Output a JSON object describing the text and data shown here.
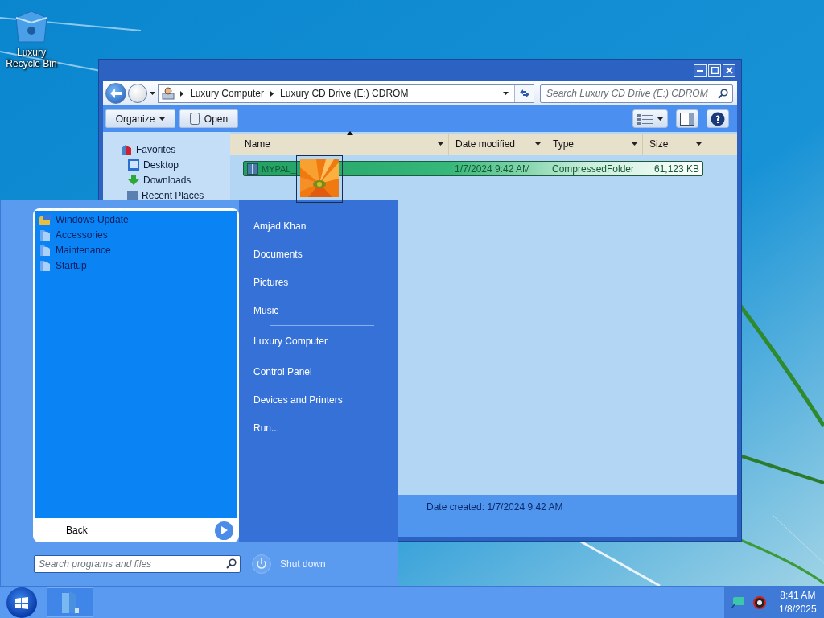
{
  "desktop": {
    "icons": [
      {
        "label": "Luxury Recycle Bin",
        "kind": "recycle-bin"
      }
    ]
  },
  "explorer": {
    "address": {
      "crumbs": [
        "Luxury Computer",
        "Luxury CD Drive (E:) CDROM"
      ]
    },
    "search": {
      "placeholder": "Search Luxury CD Drive (E:) CDROM"
    },
    "toolbar": [
      {
        "label": "Organize",
        "kind": "menu"
      },
      {
        "label": "Open",
        "kind": "open"
      }
    ],
    "navigation": [
      {
        "label": "Favorites",
        "kind": "favorites",
        "children": [
          {
            "label": "Desktop",
            "kind": "desktop"
          },
          {
            "label": "Downloads",
            "kind": "downloads"
          },
          {
            "label": "Recent Places",
            "kind": "recent"
          }
        ]
      }
    ],
    "columns": [
      {
        "label": "Name",
        "sorted": true
      },
      {
        "label": "Date modified",
        "sorted": false
      },
      {
        "label": "Type",
        "sorted": false
      },
      {
        "label": "Size",
        "sorted": false
      }
    ],
    "rows": [
      {
        "name": "MYPAL_",
        "date_modified": "1/7/2024 9:42 AM",
        "type": "CompressedFolder",
        "size": "61,123 KB",
        "selected": true
      }
    ],
    "details": {
      "text": "Date created: 1/7/2024 9:42 AM"
    }
  },
  "start_menu": {
    "programs": [
      {
        "label": "Windows Update",
        "kind": "update"
      },
      {
        "label": "Accessories",
        "kind": "folder"
      },
      {
        "label": "Maintenance",
        "kind": "folder"
      },
      {
        "label": "Startup",
        "kind": "folder"
      }
    ],
    "back": "Back",
    "search": {
      "placeholder": "Search programs and files"
    },
    "places": [
      {
        "kind": "link",
        "label": "Amjad Khan"
      },
      {
        "kind": "link",
        "label": "Documents"
      },
      {
        "kind": "link",
        "label": "Pictures"
      },
      {
        "kind": "link",
        "label": "Music"
      },
      {
        "kind": "separator"
      },
      {
        "kind": "link",
        "label": "Luxury Computer"
      },
      {
        "kind": "separator"
      },
      {
        "kind": "link",
        "label": "Control Panel"
      },
      {
        "kind": "link",
        "label": "Devices and Printers"
      },
      {
        "kind": "link",
        "label": "Run..."
      }
    ],
    "shutdown": "Shut down"
  },
  "taskbar": {
    "apps": [
      {
        "kind": "explorer",
        "selected": true
      }
    ],
    "clock": {
      "time": "8:41 AM",
      "date": "1/8/2025"
    }
  }
}
